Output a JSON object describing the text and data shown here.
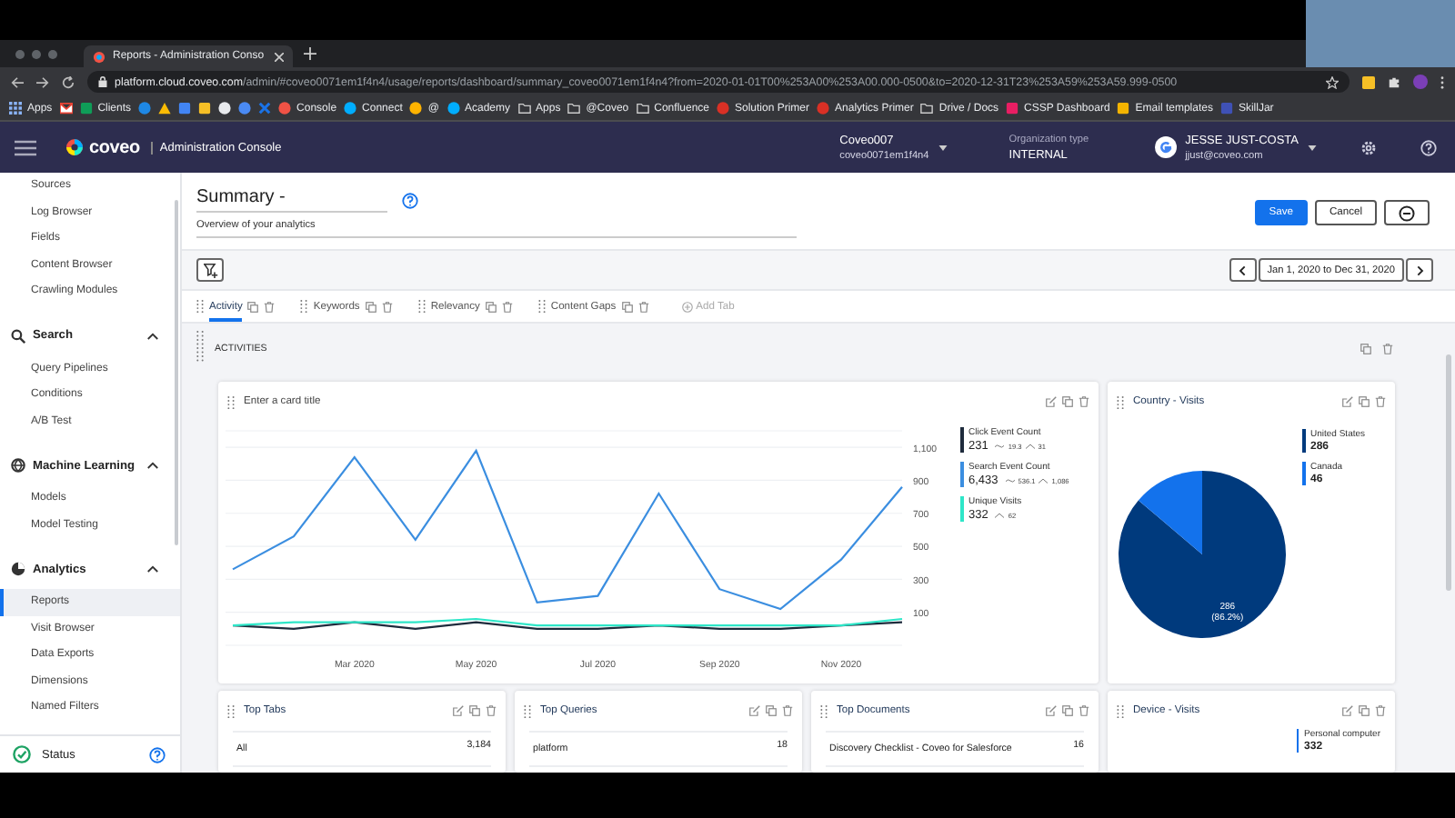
{
  "browser": {
    "tab_title": "Reports - Administration Conso",
    "address": {
      "host": "platform.cloud.coveo.com",
      "path": "/admin/#coveo0071em1f4n4/usage/reports/dashboard/summary_coveo0071em1f4n4?from=2020-01-01T00%253A00%253A00.000-0500&to=2020-12-31T23%253A59%253A59.999-0500"
    },
    "bookmarks": [
      {
        "kind": "grid",
        "label": "Apps"
      },
      {
        "kind": "mail",
        "color": "#ea4335"
      },
      {
        "kind": "square",
        "label": "Clients",
        "color": "#0f9d58"
      },
      {
        "kind": "circle",
        "color": "#1e88e5"
      },
      {
        "kind": "triangle",
        "color": "#fbbc04"
      },
      {
        "kind": "square",
        "color": "#4285f4"
      },
      {
        "kind": "square",
        "color": "#f6bf26"
      },
      {
        "kind": "circle",
        "color": "#e8eaed"
      },
      {
        "kind": "circle",
        "color": "#4a8af4"
      },
      {
        "kind": "cross",
        "color": "#1a73e8"
      },
      {
        "kind": "circle",
        "label": "Console",
        "color": "#f05245"
      },
      {
        "kind": "circle",
        "label": "Connect",
        "color": "#00adff"
      },
      {
        "kind": "circle",
        "label": "@",
        "color": "#ffb300"
      },
      {
        "kind": "circle",
        "label": "Academy",
        "color": "#00adff"
      },
      {
        "kind": "folder",
        "label": "Apps"
      },
      {
        "kind": "folder",
        "label": "@Coveo"
      },
      {
        "kind": "folder",
        "label": "Confluence"
      },
      {
        "kind": "circle",
        "label": "Solution Primer",
        "color": "#d93025"
      },
      {
        "kind": "circle",
        "label": "Analytics Primer",
        "color": "#d93025"
      },
      {
        "kind": "folder",
        "label": "Drive / Docs"
      },
      {
        "kind": "square",
        "label": "CSSP Dashboard",
        "color": "#e91e63"
      },
      {
        "kind": "square",
        "label": "Email templates",
        "color": "#f4b400"
      },
      {
        "kind": "square",
        "label": "SkillJar",
        "color": "#3f51b5"
      }
    ]
  },
  "app_header": {
    "logo": "coveo",
    "product": "Administration Console",
    "organization": {
      "name": "Coveo007",
      "id": "coveo0071em1f4n4"
    },
    "org_type": {
      "label": "Organization type",
      "value": "INTERNAL"
    },
    "user": {
      "name": "JESSE JUST-COSTA",
      "email": "jjust@coveo.com"
    }
  },
  "sidebar": {
    "sections": [
      {
        "children": [
          {
            "label": "Sources",
            "selected": false
          },
          {
            "label": "Log Browser",
            "selected": false
          },
          {
            "label": "Fields",
            "selected": false
          },
          {
            "label": "Content Browser",
            "selected": false
          },
          {
            "label": "Crawling Modules",
            "selected": false
          }
        ]
      },
      {
        "title": "Search",
        "expanded": true,
        "children": [
          {
            "label": "Query Pipelines",
            "selected": false
          },
          {
            "label": "Conditions",
            "selected": false
          },
          {
            "label": "A/B Test",
            "selected": false
          }
        ]
      },
      {
        "title": "Machine Learning",
        "expanded": true,
        "children": [
          {
            "label": "Models",
            "selected": false
          },
          {
            "label": "Model Testing",
            "selected": false
          }
        ]
      },
      {
        "title": "Analytics",
        "expanded": true,
        "children": [
          {
            "label": "Reports",
            "selected": true
          },
          {
            "label": "Visit Browser",
            "selected": false
          },
          {
            "label": "Data Exports",
            "selected": false
          },
          {
            "label": "Dimensions",
            "selected": false
          },
          {
            "label": "Named Filters",
            "selected": false
          }
        ]
      }
    ],
    "status": "Status"
  },
  "page": {
    "title": "Summary -",
    "description": "Overview of your analytics",
    "buttons": [
      {
        "label": "Save",
        "kind": "primary"
      },
      {
        "label": "Cancel",
        "kind": "secondary"
      }
    ],
    "date_range": "Jan 1, 2020 to Dec 31, 2020",
    "tabs": [
      {
        "kind": "tab",
        "label": "Activity",
        "selected": true
      },
      {
        "kind": "tab",
        "label": "Keywords",
        "selected": false
      },
      {
        "kind": "tab",
        "label": "Relevancy",
        "selected": false
      },
      {
        "kind": "tab",
        "label": "Content Gaps",
        "selected": false
      },
      {
        "kind": "add",
        "label": "Add Tab"
      }
    ],
    "section_title": "ACTIVITIES"
  },
  "cards": [
    {
      "kind": "line",
      "placeholder": "Enter a card title",
      "legend": [
        {
          "total": "231",
          "average": "19.3",
          "peak": "31"
        },
        {
          "total": "6,433",
          "average": "536.1",
          "peak": "1,086"
        },
        {
          "total": "332",
          "peak": "62"
        }
      ],
      "chart_data": {
        "type": "line",
        "categories": [
          null,
          null,
          "Mar 2020",
          null,
          "May 2020",
          null,
          "Jul 2020",
          null,
          "Sep 2020",
          null,
          "Nov 2020",
          null
        ],
        "yticks": [
          100,
          300,
          500,
          700,
          900,
          {
            "value": 1100,
            "label": "1,100"
          }
        ],
        "ylim": [
          -100,
          1200
        ],
        "grid": true,
        "series": [
          {
            "name": "Click Event Count",
            "color": "#1e2b3c",
            "values": [
              20,
              0,
              40,
              0,
              40,
              0,
              0,
              20,
              0,
              0,
              20,
              40
            ]
          },
          {
            "name": "Search Event Count",
            "color": "#3b8ee0",
            "values": [
              360,
              560,
              1040,
              540,
              1080,
              160,
              200,
              820,
              240,
              120,
              420,
              860
            ]
          },
          {
            "name": "Unique Visits",
            "color": "#2ee6c8",
            "values": [
              20,
              40,
              40,
              40,
              60,
              20,
              20,
              20,
              20,
              20,
              20,
              60
            ]
          }
        ]
      }
    },
    {
      "kind": "pie",
      "title": "Country - Visits",
      "legend": [
        "286",
        "46"
      ],
      "chart_data": {
        "type": "pie",
        "categories": [
          "United States",
          "Canada"
        ],
        "values": [
          86.2,
          13.8
        ],
        "colors": [
          "#003a7d",
          "#1372ec"
        ],
        "value_labels": [
          [
            "286",
            "(86.2%)"
          ],
          null
        ]
      }
    },
    {
      "kind": "table",
      "title": "Top Tabs",
      "rows": [
        {
          "label": "All",
          "value": "3,184"
        }
      ]
    },
    {
      "kind": "table",
      "title": "Top Queries",
      "rows": [
        {
          "label": "platform",
          "value": "18"
        }
      ]
    },
    {
      "kind": "table",
      "title": "Top Documents",
      "rows": [
        {
          "label": "Discovery Checklist - Coveo for Salesforce",
          "value": "16"
        }
      ]
    },
    {
      "kind": "legend",
      "title": "Device - Visits",
      "legend": [
        {
          "name": "Personal computer",
          "value": "332",
          "color": "#1372ec"
        }
      ]
    }
  ]
}
